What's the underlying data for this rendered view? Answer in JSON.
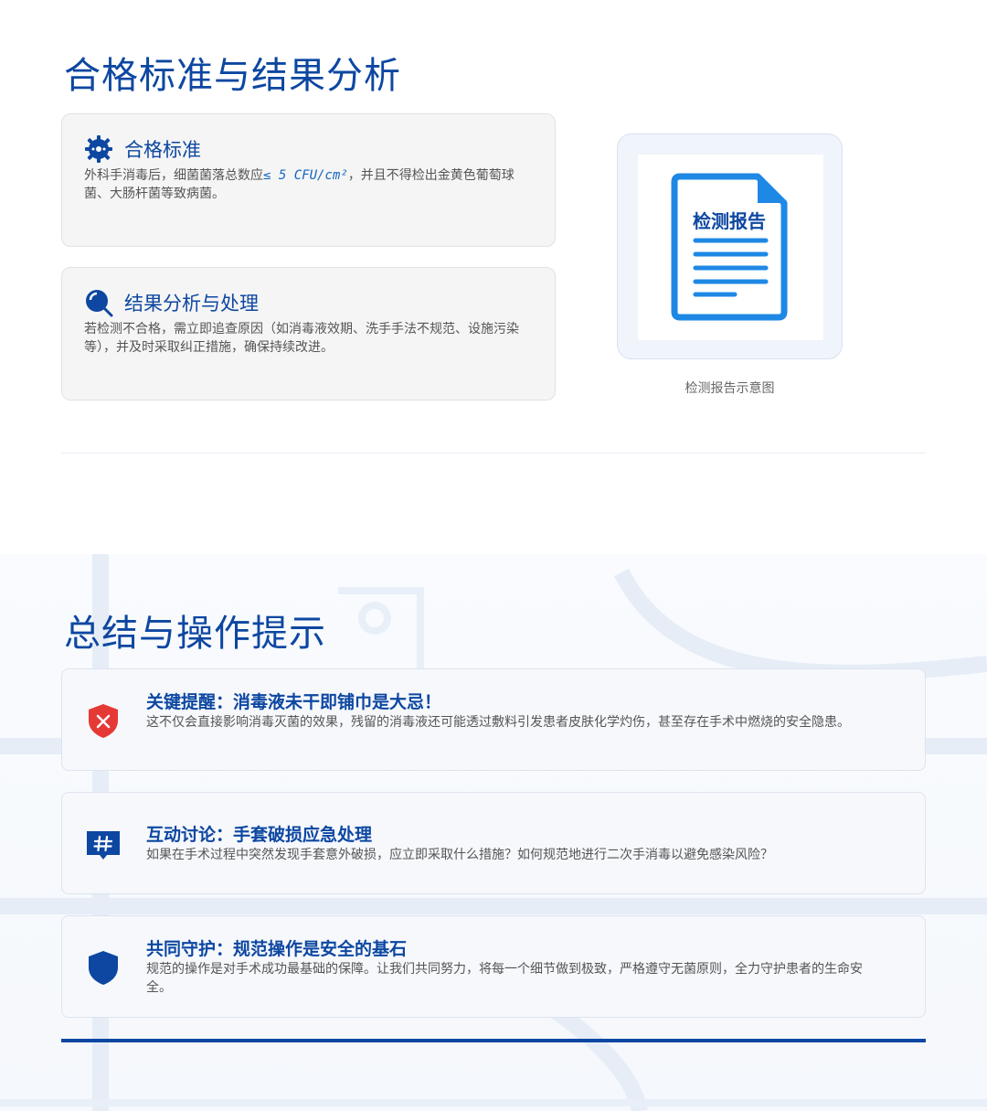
{
  "section1": {
    "title": "合格标准与结果分析",
    "standard": {
      "heading": "合格标准",
      "text_before": "外科手消毒后，细菌菌落总数应",
      "cfu": "≤ 5 CFU/cm²",
      "text_after": "，并且不得检出金黄色葡萄球菌、大肠杆菌等致病菌。"
    },
    "analysis": {
      "heading": "结果分析与处理",
      "text": "若检测不合格，需立即追查原因（如消毒液效期、洗手手法不规范、设施污染等），并及时采取纠正措施，确保持续改进。"
    },
    "report": {
      "doc_label": "检测报告",
      "caption": "检测报告示意图"
    }
  },
  "section2": {
    "title": "总结与操作提示",
    "tips": [
      {
        "title": "关键提醒：消毒液未干即铺巾是大忌！",
        "text": "这不仅会直接影响消毒灭菌的效果，残留的消毒液还可能透过敷料引发患者皮肤化学灼伤，甚至存在手术中燃烧的安全隐患。"
      },
      {
        "title": "互动讨论：手套破损应急处理",
        "text": "如果在手术过程中突然发现手套意外破损，应立即采取什么措施？如何规范地进行二次手消毒以避免感染风险？"
      },
      {
        "title": "共同守护：规范操作是安全的基石",
        "text": "规范的操作是对手术成功最基础的保障。让我们共同努力，将每一个细节做到极致，严格遵守无菌原则，全力守护患者的生命安全。"
      }
    ]
  },
  "colors": {
    "primary": "#0d47a1",
    "accent": "#1e88e5",
    "danger": "#e53935"
  },
  "icons": {
    "standard": "gear-badge-icon",
    "analysis": "magnifier-icon",
    "report": "document-icon",
    "tip1": "shield-x-icon",
    "tip2": "hashtag-chat-icon",
    "tip3": "shield-icon"
  }
}
